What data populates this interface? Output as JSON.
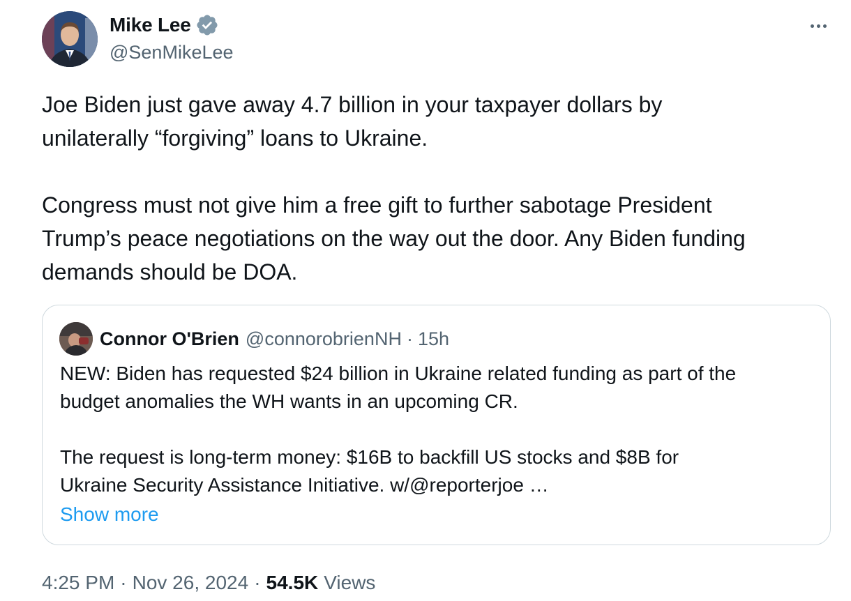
{
  "author": {
    "display_name": "Mike Lee",
    "handle": "@SenMikeLee",
    "verified": true,
    "avatar_icon": "profile-photo"
  },
  "tweet": {
    "text": "Joe Biden just gave away 4.7 billion in your taxpayer dollars by\nunilaterally “forgiving” loans to Ukraine.\n\nCongress must not give him a free gift to further sabotage President\nTrump’s peace negotiations on the way out the door. Any Biden funding\ndemands should be DOA."
  },
  "quoted_tweet": {
    "display_name": "Connor O'Brien",
    "handle": "@connorobrienNH",
    "separator": "·",
    "time": "15h",
    "text": "NEW: Biden has requested $24 billion in Ukraine related funding as part of the\nbudget anomalies the WH wants in an upcoming CR.\n\nThe request is long-term money: $16B to backfill US stocks and $8B for\nUkraine Security Assistance Initiative. w/@reporterjoe …",
    "show_more": "Show more"
  },
  "meta": {
    "time": "4:25 PM",
    "separator": "·",
    "date": "Nov 26, 2024",
    "views_count": "54.5K",
    "views_label": "Views"
  },
  "colors": {
    "text_primary": "#0f1419",
    "text_secondary": "#536471",
    "link": "#1d9bf0",
    "border": "#cfd9de",
    "verified_badge": "#829aab"
  },
  "icons": {
    "more": "more-horizontal-icon",
    "verified": "verified-badge-icon"
  }
}
